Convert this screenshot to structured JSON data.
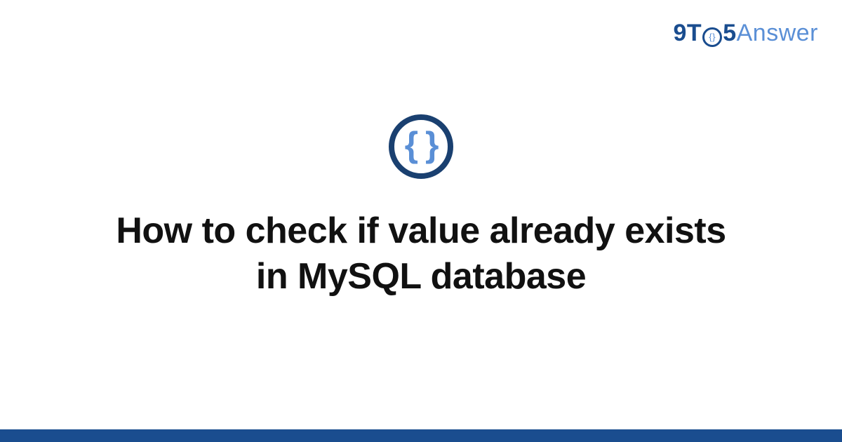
{
  "logo": {
    "part1": "9T",
    "part_circle": "{}",
    "part2": "5",
    "part3": "Answer"
  },
  "icon": {
    "braces": "{ }"
  },
  "title": "How to check if value already exists in MySQL database"
}
